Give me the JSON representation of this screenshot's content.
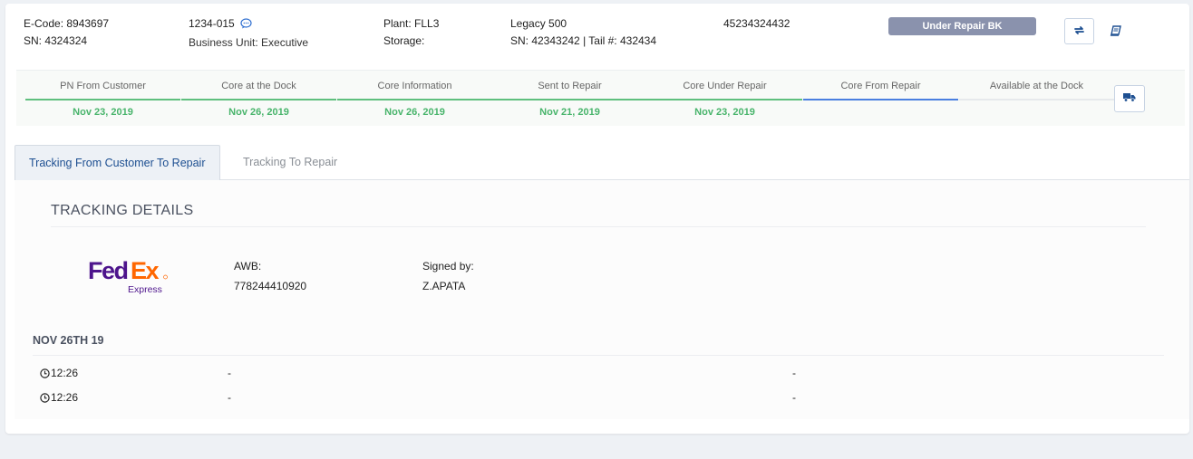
{
  "header": {
    "ecode": "E-Code: 8943697",
    "sn": "SN: 4324324",
    "part": "1234-015",
    "business_unit": "Business Unit: Executive",
    "plant": "Plant: FLL3",
    "storage": "Storage:",
    "model": "Legacy 500",
    "sn_tail": "SN: 42343242 | Tail #: 432434",
    "number": "45234324432",
    "status": "Under Repair BK",
    "status_color": "#8a92ad",
    "refresh_icon": "refresh-icon",
    "book_icon": "book-icon"
  },
  "timeline": {
    "steps": [
      {
        "label": "PN From Customer",
        "date": "Nov 23, 2019",
        "state": "done"
      },
      {
        "label": "Core at the Dock",
        "date": "Nov 26, 2019",
        "state": "done"
      },
      {
        "label": "Core Information",
        "date": "Nov 26, 2019",
        "state": "done"
      },
      {
        "label": "Sent to Repair",
        "date": "Nov 21, 2019",
        "state": "done"
      },
      {
        "label": "Core Under Repair",
        "date": "Nov 23, 2019",
        "state": "done"
      },
      {
        "label": "Core From Repair",
        "date": "",
        "state": "current"
      },
      {
        "label": "Available at the Dock",
        "date": "",
        "state": "pending"
      }
    ],
    "done_color": "#5fbf7e",
    "current_color": "#4a7fe0",
    "truck_icon": "truck-icon"
  },
  "tabs": [
    {
      "label": "Tracking From Customer To Repair",
      "active": true
    },
    {
      "label": "Tracking To Repair",
      "active": false
    }
  ],
  "tracking": {
    "title": "TRACKING DETAILS",
    "carrier_logo_text": "FedEx",
    "carrier_sub": "Express",
    "awb_label": "AWB:",
    "awb_value": "778244410920",
    "signed_label": "Signed by:",
    "signed_value": "Z.APATA",
    "date_heading": "NOV 26TH 19",
    "events": [
      {
        "time": "12:26",
        "col2": "-",
        "col3": "-"
      },
      {
        "time": "12:26",
        "col2": "-",
        "col3": "-"
      }
    ]
  }
}
